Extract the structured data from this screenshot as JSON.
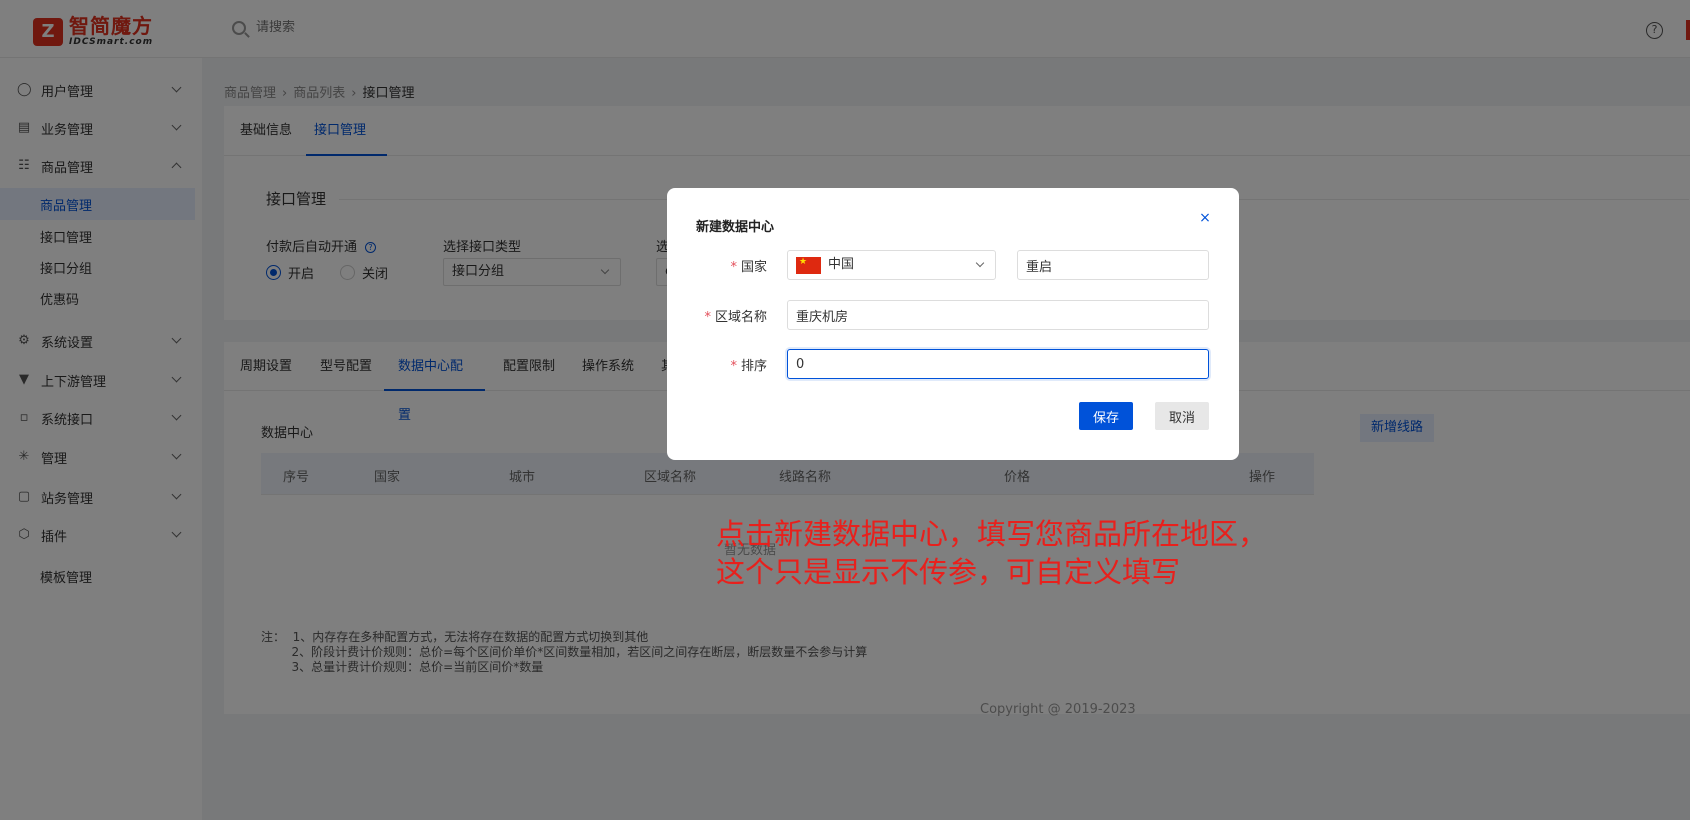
{
  "header": {
    "logo_cn": "智简魔方",
    "logo_en": "IDCSmart.com",
    "logo_mark": "Z",
    "search_placeholder": "请搜索",
    "help_glyph": "?"
  },
  "sidebar": {
    "items": [
      {
        "label": "用户管理",
        "icon": "user-icon"
      },
      {
        "label": "业务管理",
        "icon": "list-icon"
      },
      {
        "label": "商品管理",
        "icon": "cart-icon",
        "expanded": true
      },
      {
        "label": "系统设置",
        "icon": "settings-icon"
      },
      {
        "label": "上下游管理",
        "icon": "filter-icon"
      },
      {
        "label": "系统接口",
        "icon": "folder-icon"
      },
      {
        "label": "管理",
        "icon": "asterisk-icon"
      },
      {
        "label": "站务管理",
        "icon": "station-icon"
      },
      {
        "label": "插件",
        "icon": "cube-icon"
      }
    ],
    "sub_items": [
      {
        "label": "商品管理",
        "active": true
      },
      {
        "label": "接口管理"
      },
      {
        "label": "接口分组"
      },
      {
        "label": "优惠码"
      }
    ],
    "extra_item": "模板管理"
  },
  "breadcrumb": [
    "商品管理",
    "商品列表",
    "接口管理"
  ],
  "top_tabs": [
    "基础信息",
    "接口管理"
  ],
  "interface_section": {
    "title": "接口管理",
    "auto_open_label": "付款后自动开通",
    "radio_on": "开启",
    "radio_off": "关闭",
    "type_label": "选择接口类型",
    "type_value": "接口分组",
    "third_label": "选",
    "third_value": "c"
  },
  "config_tabs": [
    "周期设置",
    "型号配置",
    "数据中心配置",
    "配置限制",
    "操作系统",
    "其"
  ],
  "datacenter": {
    "title": "数据中心",
    "new_line_button": "新增线路",
    "columns": [
      "序号",
      "国家",
      "城市",
      "区域名称",
      "线路名称",
      "价格",
      "操作"
    ],
    "empty_text": "暂无数据",
    "notes": [
      "注：  1、内存存在多种配置方式，无法将存在数据的配置方式切换到其他",
      "        2、阶段计费计价规则：总价=每个区间价单价*区间数量相加，若区间之间存在断层，断层数量不会参与计算",
      "        3、总量计费计价规则：总价=当前区间价*数量"
    ]
  },
  "copyright": "Copyright @ 2019-2023",
  "modal": {
    "title": "新建数据中心",
    "close_glyph": "×",
    "country_label": "国家",
    "country_value": "中国",
    "city_value": "重启",
    "region_label": "区域名称",
    "region_value": "重庆机房",
    "order_label": "排序",
    "order_value": "0",
    "save_button": "保存",
    "cancel_button": "取消"
  },
  "annotation": {
    "line1": "点击新建数据中心，填写您商品所在地区，",
    "line2": "这个只是显示不传参，可自定义填写",
    "color": "#e8201c"
  },
  "colors": {
    "primary": "#0052d9",
    "brand": "#e0301e"
  }
}
